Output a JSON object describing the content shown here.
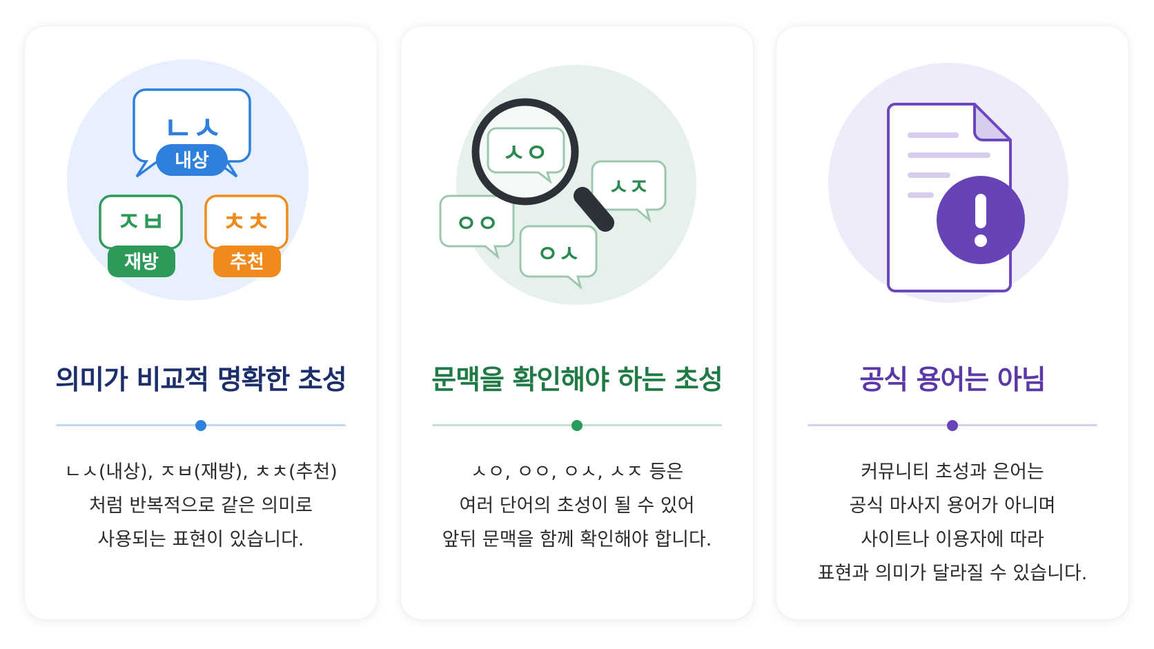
{
  "cards": [
    {
      "title": "의미가 비교적 명확한 초성",
      "lines": [
        "ㄴㅅ(내상), ㅈㅂ(재방), ㅊㅊ(추천)",
        "처럼 반복적으로 같은 의미로",
        "사용되는 표현이 있습니다."
      ],
      "bubbles": [
        {
          "initials": "ㄴㅅ",
          "word": "내상"
        },
        {
          "initials": "ㅈㅂ",
          "word": "재방"
        },
        {
          "initials": "ㅊㅊ",
          "word": "추천"
        }
      ],
      "colors": {
        "accent": "#2f7fdc",
        "green": "#2e9a5a",
        "orange": "#f08a1c",
        "title": "#1c2f6b"
      }
    },
    {
      "title": "문맥을 확인해야 하는 초성",
      "lines": [
        "ㅅㅇ, ㅇㅇ, ㅇㅅ, ㅅㅈ 등은",
        "여러 단어의 초성이 될 수 있어",
        "앞뒤 문맥을 함께 확인해야 합니다."
      ],
      "bubbles": [
        {
          "initials": "ㅅㅇ"
        },
        {
          "initials": "ㅅㅈ"
        },
        {
          "initials": "ㅇㅇ"
        },
        {
          "initials": "ㅇㅅ"
        }
      ],
      "colors": {
        "accent": "#2b9a5c",
        "title": "#1f7a45"
      }
    },
    {
      "title": "공식 용어는 아님",
      "lines": [
        "커뮤니티 초성과 은어는",
        "공식 마사지 용어가 아니며",
        "사이트나 이용자에 따라",
        "표현과 의미가 달라질 수 있습니다."
      ],
      "icons": [
        "document-icon",
        "warning-icon"
      ],
      "colors": {
        "accent": "#6644b8",
        "title": "#5b38a6"
      }
    }
  ]
}
